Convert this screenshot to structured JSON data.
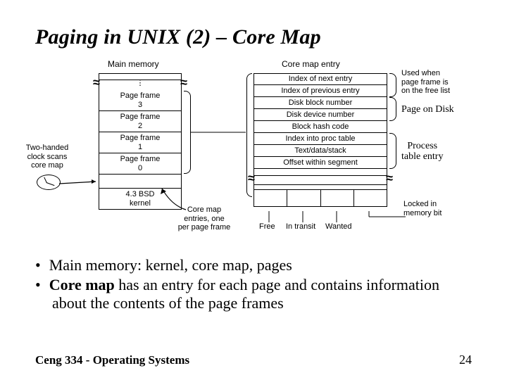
{
  "title": "Paging in UNIX (2) – Core Map",
  "main_memory": {
    "label": "Main memory",
    "frames": [
      "Page frame\n3",
      "Page frame\n2",
      "Page frame\n1",
      "Page frame\n0"
    ],
    "kernel": "4.3 BSD\nkernel"
  },
  "core_map_entry": {
    "label": "Core map entry",
    "rows": [
      "Index of next entry",
      "Index of previous entry",
      "Disk block number",
      "Disk device number",
      "Block hash code",
      "Index into proc table",
      "Text/data/stack",
      "Offset within segment"
    ],
    "bottom_flags": [
      "Free",
      "In transit",
      "Wanted",
      ""
    ],
    "bottom_right_note": "Locked in\nmemory bit"
  },
  "annotations": {
    "left_note": "Two-handed\nclock scans\ncore map",
    "core_map_entries_note": "Core map\nentries, one\nper page frame",
    "free_list_note": "Used when\npage frame is\non the free list",
    "page_on_disk": "Page on Disk",
    "process_table_entry": "Process\ntable entry"
  },
  "bullets": [
    "Main memory: kernel, core map, pages",
    "Core map has an entry for each page and contains information about the contents of the page frames"
  ],
  "footer": {
    "course": "Ceng 334 - Operating Systems",
    "page": "24"
  }
}
